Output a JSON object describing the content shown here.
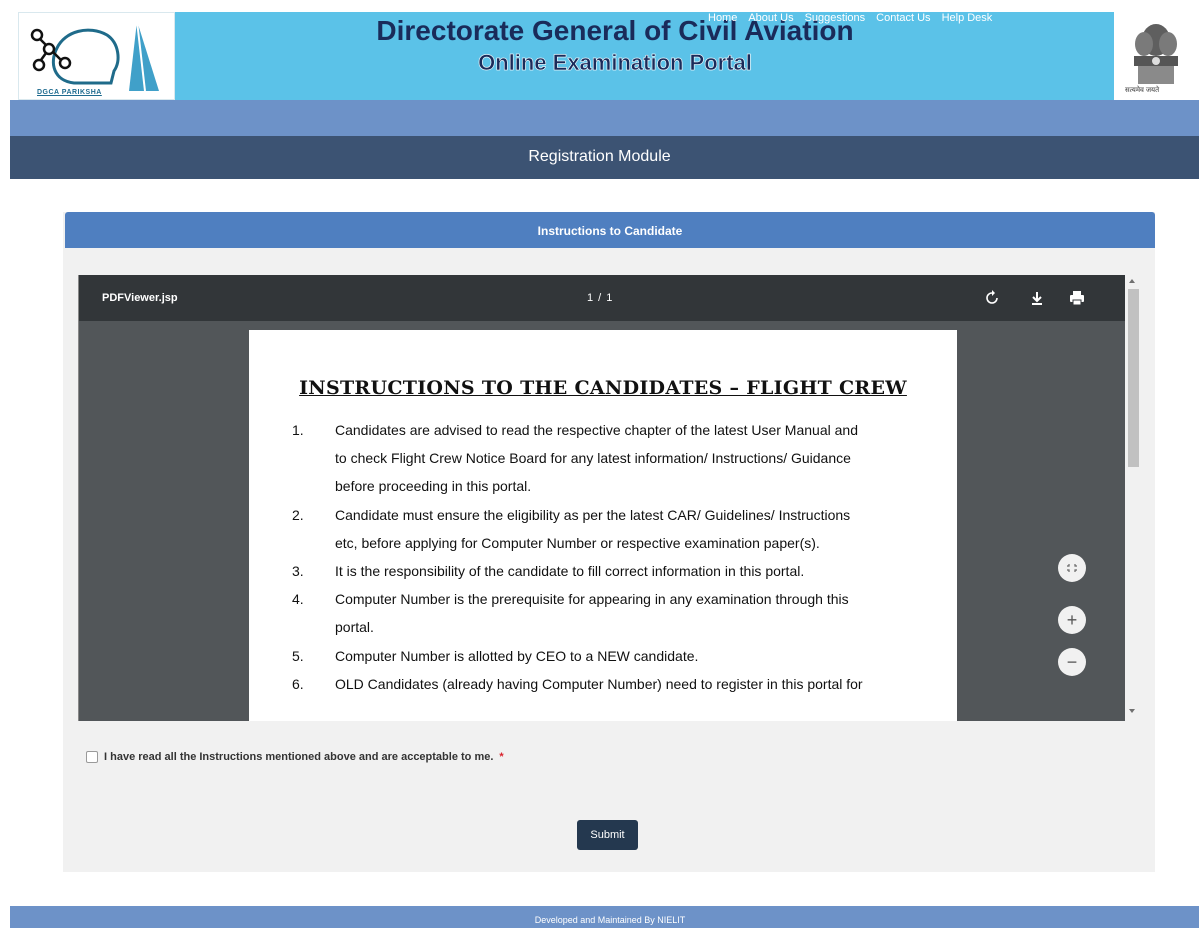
{
  "header": {
    "logo_text": "DGCA PARIKSHA",
    "title": "Directorate General of Civil Aviation",
    "subtitle": "Online Examination Portal",
    "emblem_caption": "सत्यमेव जयते"
  },
  "nav": {
    "items": [
      "Home",
      "About Us",
      "Suggestions",
      "Contact Us",
      "Help Desk"
    ]
  },
  "module": {
    "title": "Registration Module"
  },
  "panel": {
    "title": "Instructions to Candidate"
  },
  "viewer": {
    "file_name": "PDFViewer.jsp",
    "page_indicator": "1 / 1",
    "icons": [
      "rotate-icon",
      "download-icon",
      "print-icon",
      "fit-page-icon",
      "zoom-in-icon",
      "zoom-out-icon"
    ]
  },
  "document": {
    "heading": "INSTRUCTIONS TO THE CANDIDATES – FLIGHT CREW",
    "items": [
      {
        "num": "1.",
        "lines": [
          "Candidates are advised to read the respective chapter of the latest User Manual and",
          "to check Flight Crew Notice Board for any latest information/ Instructions/ Guidance",
          "before proceeding in this portal."
        ]
      },
      {
        "num": "2.",
        "lines": [
          "Candidate must ensure the eligibility as per the latest CAR/ Guidelines/ Instructions",
          "etc, before applying for Computer Number or respective examination paper(s)."
        ]
      },
      {
        "num": "3.",
        "lines": [
          "It is the responsibility of the candidate to fill correct information in this portal."
        ]
      },
      {
        "num": "4.",
        "lines": [
          "Computer Number is the prerequisite for appearing in any examination through this",
          "portal."
        ]
      },
      {
        "num": "5.",
        "lines": [
          "Computer Number is allotted by CEO to a NEW candidate."
        ]
      },
      {
        "num": "6.",
        "lines": [
          "OLD Candidates (already having Computer Number) need to register in this portal for"
        ]
      }
    ]
  },
  "agreement": {
    "label": "I have read all the Instructions mentioned above and are acceptable to me.",
    "required_mark": "*",
    "checked": false
  },
  "submit_label": "Submit",
  "footer": {
    "text": "Developed and Maintained By NIELIT"
  },
  "colors": {
    "banner": "#5bc2e8",
    "nav": "#6d92c8",
    "module_bar": "#3c5373",
    "panel_head": "#4f7fc0",
    "submit": "#24384f"
  }
}
